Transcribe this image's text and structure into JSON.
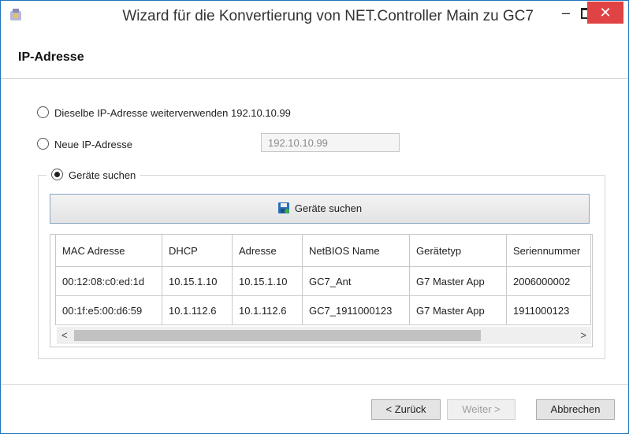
{
  "window": {
    "title": "Wizard für die Konvertierung von NET.Controller Main zu GC7",
    "minimize_label": "–",
    "close_label": "✕"
  },
  "header": {
    "title": "IP-Adresse"
  },
  "options": {
    "reuse_ip_label": "Dieselbe IP-Adresse weiterverwenden 192.10.10.99",
    "new_ip_label": "Neue IP-Adresse",
    "new_ip_value": "192.10.10.99",
    "search_devices_label": "Geräte suchen",
    "selected": "search_devices"
  },
  "search_button": {
    "label": "Geräte suchen",
    "icon": "floppy-disk-icon"
  },
  "table": {
    "columns": [
      "MAC Adresse",
      "DHCP",
      "Adresse",
      "NetBIOS Name",
      "Gerätetyp",
      "Seriennummer"
    ],
    "rows": [
      [
        "00:12:08:c0:ed:1d",
        "10.15.1.10",
        "10.15.1.10",
        "GC7_Ant",
        "G7 Master App",
        "2006000002"
      ],
      [
        "00:1f:e5:00:d6:59",
        "10.1.112.6",
        "10.1.112.6",
        "GC7_1911000123",
        "G7 Master App",
        "1911000123"
      ]
    ]
  },
  "scrollbar": {
    "left_arrow": "<",
    "right_arrow": ">"
  },
  "buttons": {
    "back": "< Zurück",
    "next": "Weiter >",
    "cancel": "Abbrechen"
  },
  "colors": {
    "close": "#e04343",
    "accent_border": "#1e73be"
  }
}
